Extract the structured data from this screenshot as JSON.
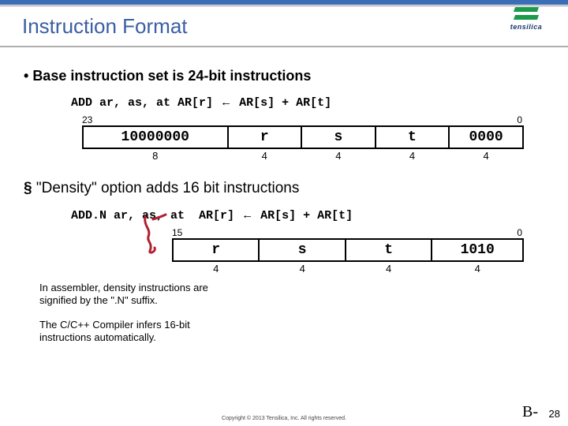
{
  "header": {
    "title": "Instruction Format",
    "logo_name": "tensilica"
  },
  "sec1": {
    "bullet": "Base instruction set is 24-bit instructions",
    "code_lhs": "ADD ar, as, at",
    "code_sep": "   ",
    "code_rhs1": "AR[r] ",
    "arrow": "←",
    "code_rhs2": " AR[s] + AR[t]",
    "bit_hi": "23",
    "bit_lo": "0",
    "fields": {
      "opcode": "10000000",
      "r": "r",
      "s": "s",
      "t": "t",
      "last": "0000"
    },
    "widths": {
      "opcode": "8",
      "r": "4",
      "s": "4",
      "t": "4",
      "last": "4"
    }
  },
  "sec2": {
    "bullet": "\"Density\" option adds 16 bit instructions",
    "code_lhs": "ADD.N ar, as, at",
    "code_rhs1": "AR[r] ",
    "arrow": "←",
    "code_rhs2": " AR[s] + AR[t]",
    "bit_hi": "15",
    "bit_lo": "0",
    "fields": {
      "r": "r",
      "s": "s",
      "t": "t",
      "last": "1010"
    },
    "widths": {
      "r": "4",
      "s": "4",
      "t": "4",
      "last": "4"
    }
  },
  "notes": {
    "n1": "In assembler, density instructions are signified by the \".N\" suffix.",
    "n2": "The C/C++ Compiler infers 16-bit instructions automatically."
  },
  "footer": {
    "copyright": "Copyright © 2013  Tensilica, Inc. All rights reserved.",
    "tag": "B-",
    "page": "28"
  },
  "colors": {
    "accent": "#3a6fb7",
    "title": "#3a5fa5",
    "logo_green": "#1a9a4a",
    "squiggle": "#b02030"
  }
}
